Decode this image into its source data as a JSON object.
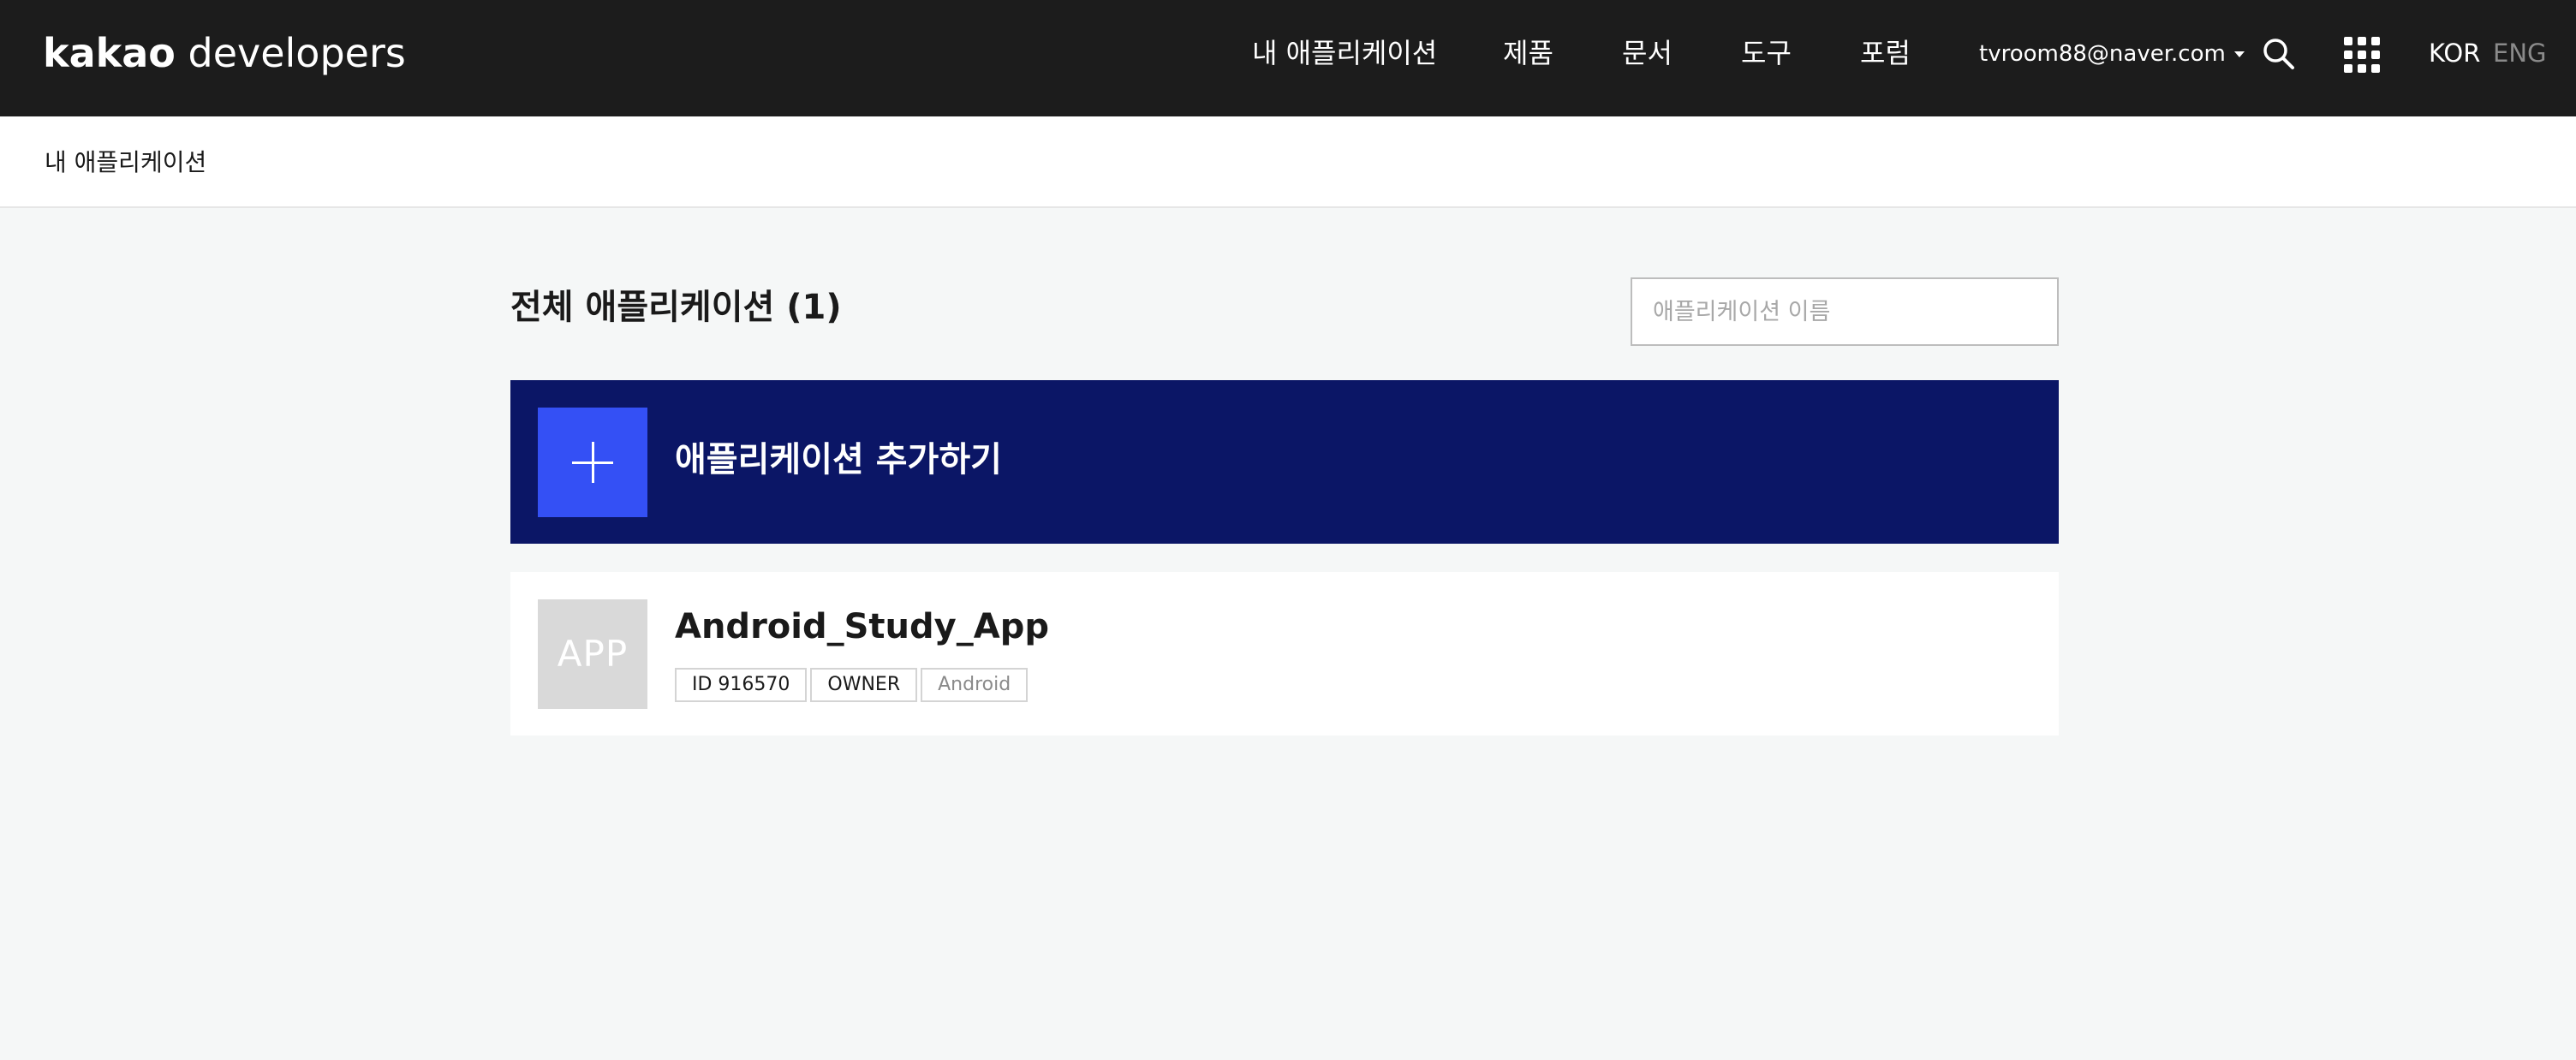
{
  "header": {
    "logo_brand": "kakao",
    "logo_product": " developers",
    "nav": [
      {
        "label": "내 애플리케이션"
      },
      {
        "label": "제품"
      },
      {
        "label": "문서"
      },
      {
        "label": "도구"
      },
      {
        "label": "포럼"
      }
    ],
    "account_email": "tvroom88@naver.com",
    "lang_active": "KOR",
    "lang_inactive": "ENG",
    "icons": [
      "search-icon",
      "apps-grid-icon",
      "caret-down-icon"
    ]
  },
  "subheader": {
    "breadcrumb": "내 애플리케이션"
  },
  "main": {
    "title": "전체 애플리케이션 (1)",
    "search_placeholder": "애플리케이션 이름",
    "add_app_label": "애플리케이션 추가하기",
    "apps": [
      {
        "thumb_text": "APP",
        "name": "Android_Study_App",
        "tags": [
          "ID 916570",
          "OWNER",
          "Android"
        ]
      }
    ]
  },
  "colors": {
    "header_bg": "#1c1c1c",
    "page_bg": "#f5f7f7",
    "add_card_bg": "#0b1666",
    "add_square_bg": "#3450f5",
    "thumb_bg": "#d9d9d9"
  }
}
